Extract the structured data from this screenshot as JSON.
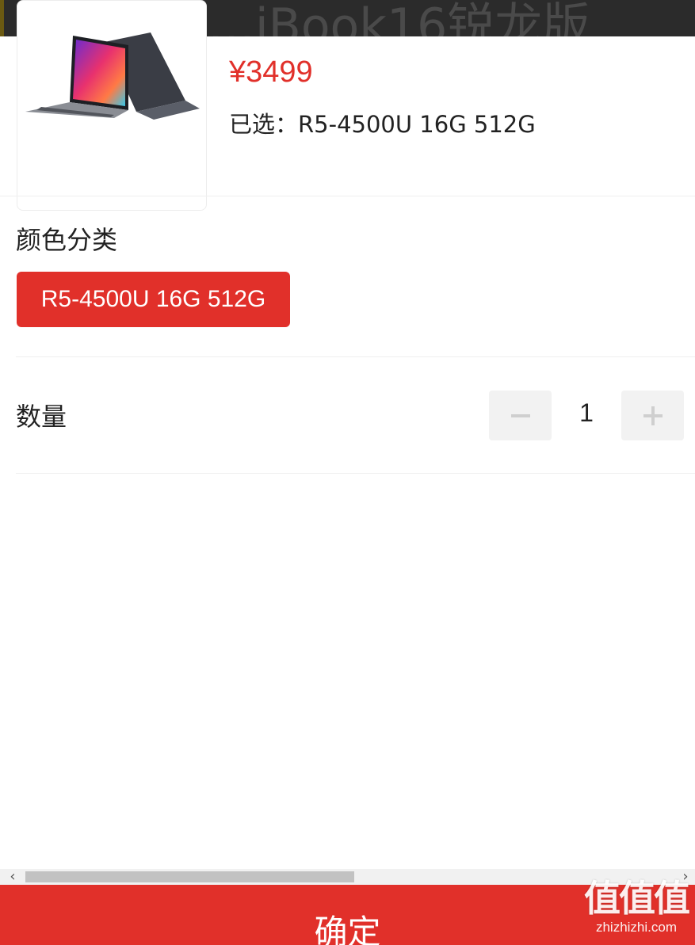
{
  "background_title": "…iBook16锐龙版",
  "product": {
    "image_icon": "laptop-image",
    "price": "¥3499",
    "selected_text": "已选：R5-4500U 16G 512G"
  },
  "color_section": {
    "title": "颜色分类",
    "options": [
      "R5-4500U 16G 512G"
    ],
    "selected_index": 0
  },
  "quantity_section": {
    "title": "数量",
    "value": "1",
    "minus_icon": "minus-icon",
    "plus_icon": "plus-icon"
  },
  "scrollbar": {
    "left_arrow": "‹",
    "right_arrow": "›"
  },
  "confirm": {
    "label": "确定"
  },
  "watermark": {
    "cn": "值值值",
    "en": "zhizhizhi.com"
  },
  "colors": {
    "accent": "#e1302a",
    "stepper_bg": "#f2f2f2"
  }
}
